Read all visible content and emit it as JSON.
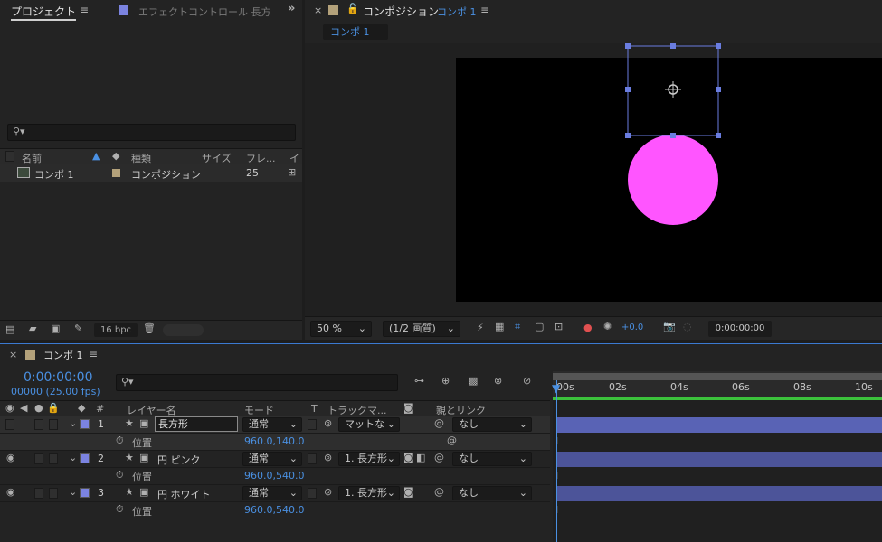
{
  "project_panel": {
    "tab_label": "プロジェクト",
    "effects_tab_label": "エフェクトコントロール 長方",
    "columns": {
      "name": "名前",
      "type": "種類",
      "size": "サイズ",
      "frame": "フレ...",
      "extra": "イ"
    },
    "item": {
      "name": "コンポ 1",
      "type": "コンポジション",
      "frame": "25"
    },
    "bpc": "16 bpc"
  },
  "comp_panel": {
    "title": "コンポジション",
    "comp_name": "コンポ 1",
    "subtab": "コンポ 1",
    "zoom": "50 %",
    "resolution": "(1/2 画質)",
    "exposure": "+0.0",
    "timecode": "0:00:00:00",
    "circle_color": "#ff55ff"
  },
  "timeline": {
    "tab_label": "コンポ 1",
    "current_time": "0:00:00:00",
    "fps": "00000 (25.00 fps)",
    "headers": {
      "num": "#",
      "layer_name": "レイヤー名",
      "mode": "モード",
      "t": "T",
      "track_matte": "トラックマ...",
      "parent": "親とリンク"
    },
    "ruler_ticks": [
      "00s",
      "02s",
      "04s",
      "06s",
      "08s",
      "10s"
    ],
    "layers": [
      {
        "num": "1",
        "name": "長方形",
        "mode": "通常",
        "matte": "マットな",
        "parent": "なし",
        "prop": "位置",
        "value": "960.0,140.0"
      },
      {
        "num": "2",
        "name": "円 ピンク",
        "mode": "通常",
        "matte": "1. 長方形",
        "parent": "なし",
        "prop": "位置",
        "value": "960.0,540.0"
      },
      {
        "num": "3",
        "name": "円 ホワイト",
        "mode": "通常",
        "matte": "1. 長方形",
        "parent": "なし",
        "prop": "位置",
        "value": "960.0,540.0"
      }
    ],
    "layer_color": "#7b83e0",
    "bar_color": "#5963b5"
  }
}
